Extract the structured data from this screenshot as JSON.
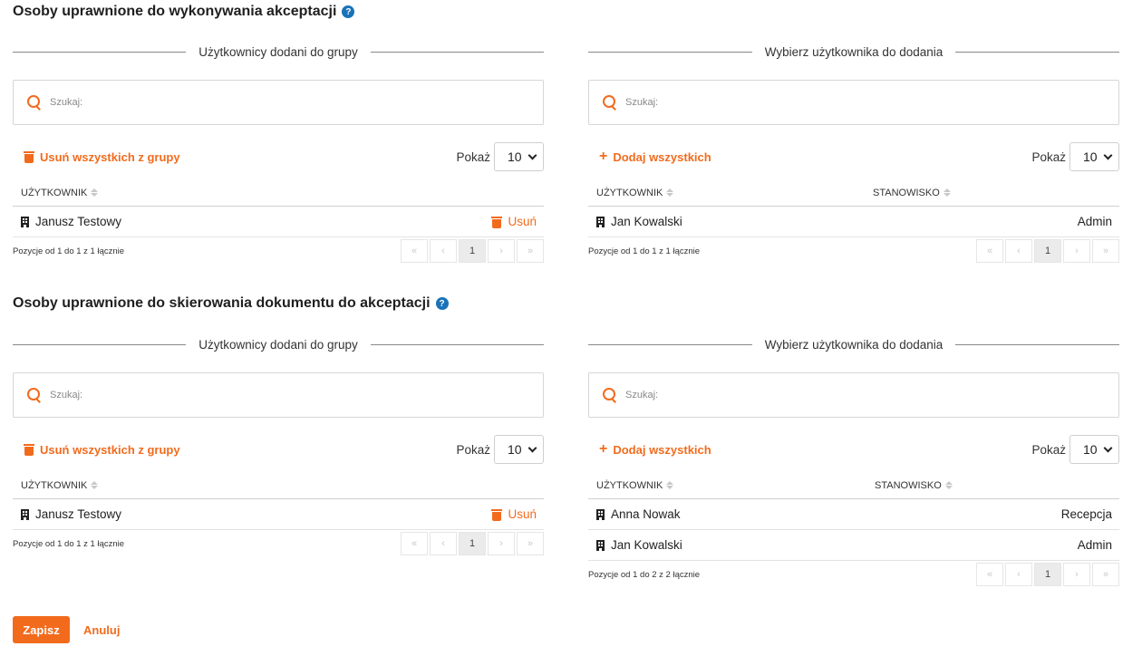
{
  "sections": [
    {
      "title": "Osoby uprawnione do wykonywania akceptacji",
      "help": "?",
      "left": {
        "heading": "Użytkownicy dodani do grupy",
        "search_placeholder": "Szukaj:",
        "action_label": "Usuń wszystkich z grupy",
        "show_label": "Pokaż",
        "show_value": "10",
        "col_user": "UŻYTKOWNIK",
        "rows": [
          {
            "name": "Janusz Testowy",
            "action": "Usuń"
          }
        ],
        "info": "Pozycje od 1 do 1 z 1 łącznie",
        "page": "1"
      },
      "right": {
        "heading": "Wybierz użytkownika do dodania",
        "search_placeholder": "Szukaj:",
        "action_label": "Dodaj wszystkich",
        "show_label": "Pokaż",
        "show_value": "10",
        "col_user": "UŻYTKOWNIK",
        "col_position": "STANOWISKO",
        "rows": [
          {
            "name": "Jan Kowalski",
            "position": "Admin"
          }
        ],
        "info": "Pozycje od 1 do 1 z 1 łącznie",
        "page": "1"
      }
    },
    {
      "title": "Osoby uprawnione do skierowania dokumentu do akceptacji",
      "help": "?",
      "left": {
        "heading": "Użytkownicy dodani do grupy",
        "search_placeholder": "Szukaj:",
        "action_label": "Usuń wszystkich z grupy",
        "show_label": "Pokaż",
        "show_value": "10",
        "col_user": "UŻYTKOWNIK",
        "rows": [
          {
            "name": "Janusz Testowy",
            "action": "Usuń"
          }
        ],
        "info": "Pozycje od 1 do 1 z 1 łącznie",
        "page": "1"
      },
      "right": {
        "heading": "Wybierz użytkownika do dodania",
        "search_placeholder": "Szukaj:",
        "action_label": "Dodaj wszystkich",
        "show_label": "Pokaż",
        "show_value": "10",
        "col_user": "UŻYTKOWNIK",
        "col_position": "STANOWISKO",
        "rows": [
          {
            "name": "Anna Nowak",
            "position": "Recepcja"
          },
          {
            "name": "Jan Kowalski",
            "position": "Admin"
          }
        ],
        "info": "Pozycje od 1 do 2 z 2 łącznie",
        "page": "1"
      }
    }
  ],
  "pager_glyphs": {
    "first": "«",
    "prev": "‹",
    "next": "›",
    "last": "»"
  },
  "buttons": {
    "save": "Zapisz",
    "cancel": "Anuluj"
  },
  "colors": {
    "accent": "#f26b1d",
    "help": "#1a73b8"
  }
}
